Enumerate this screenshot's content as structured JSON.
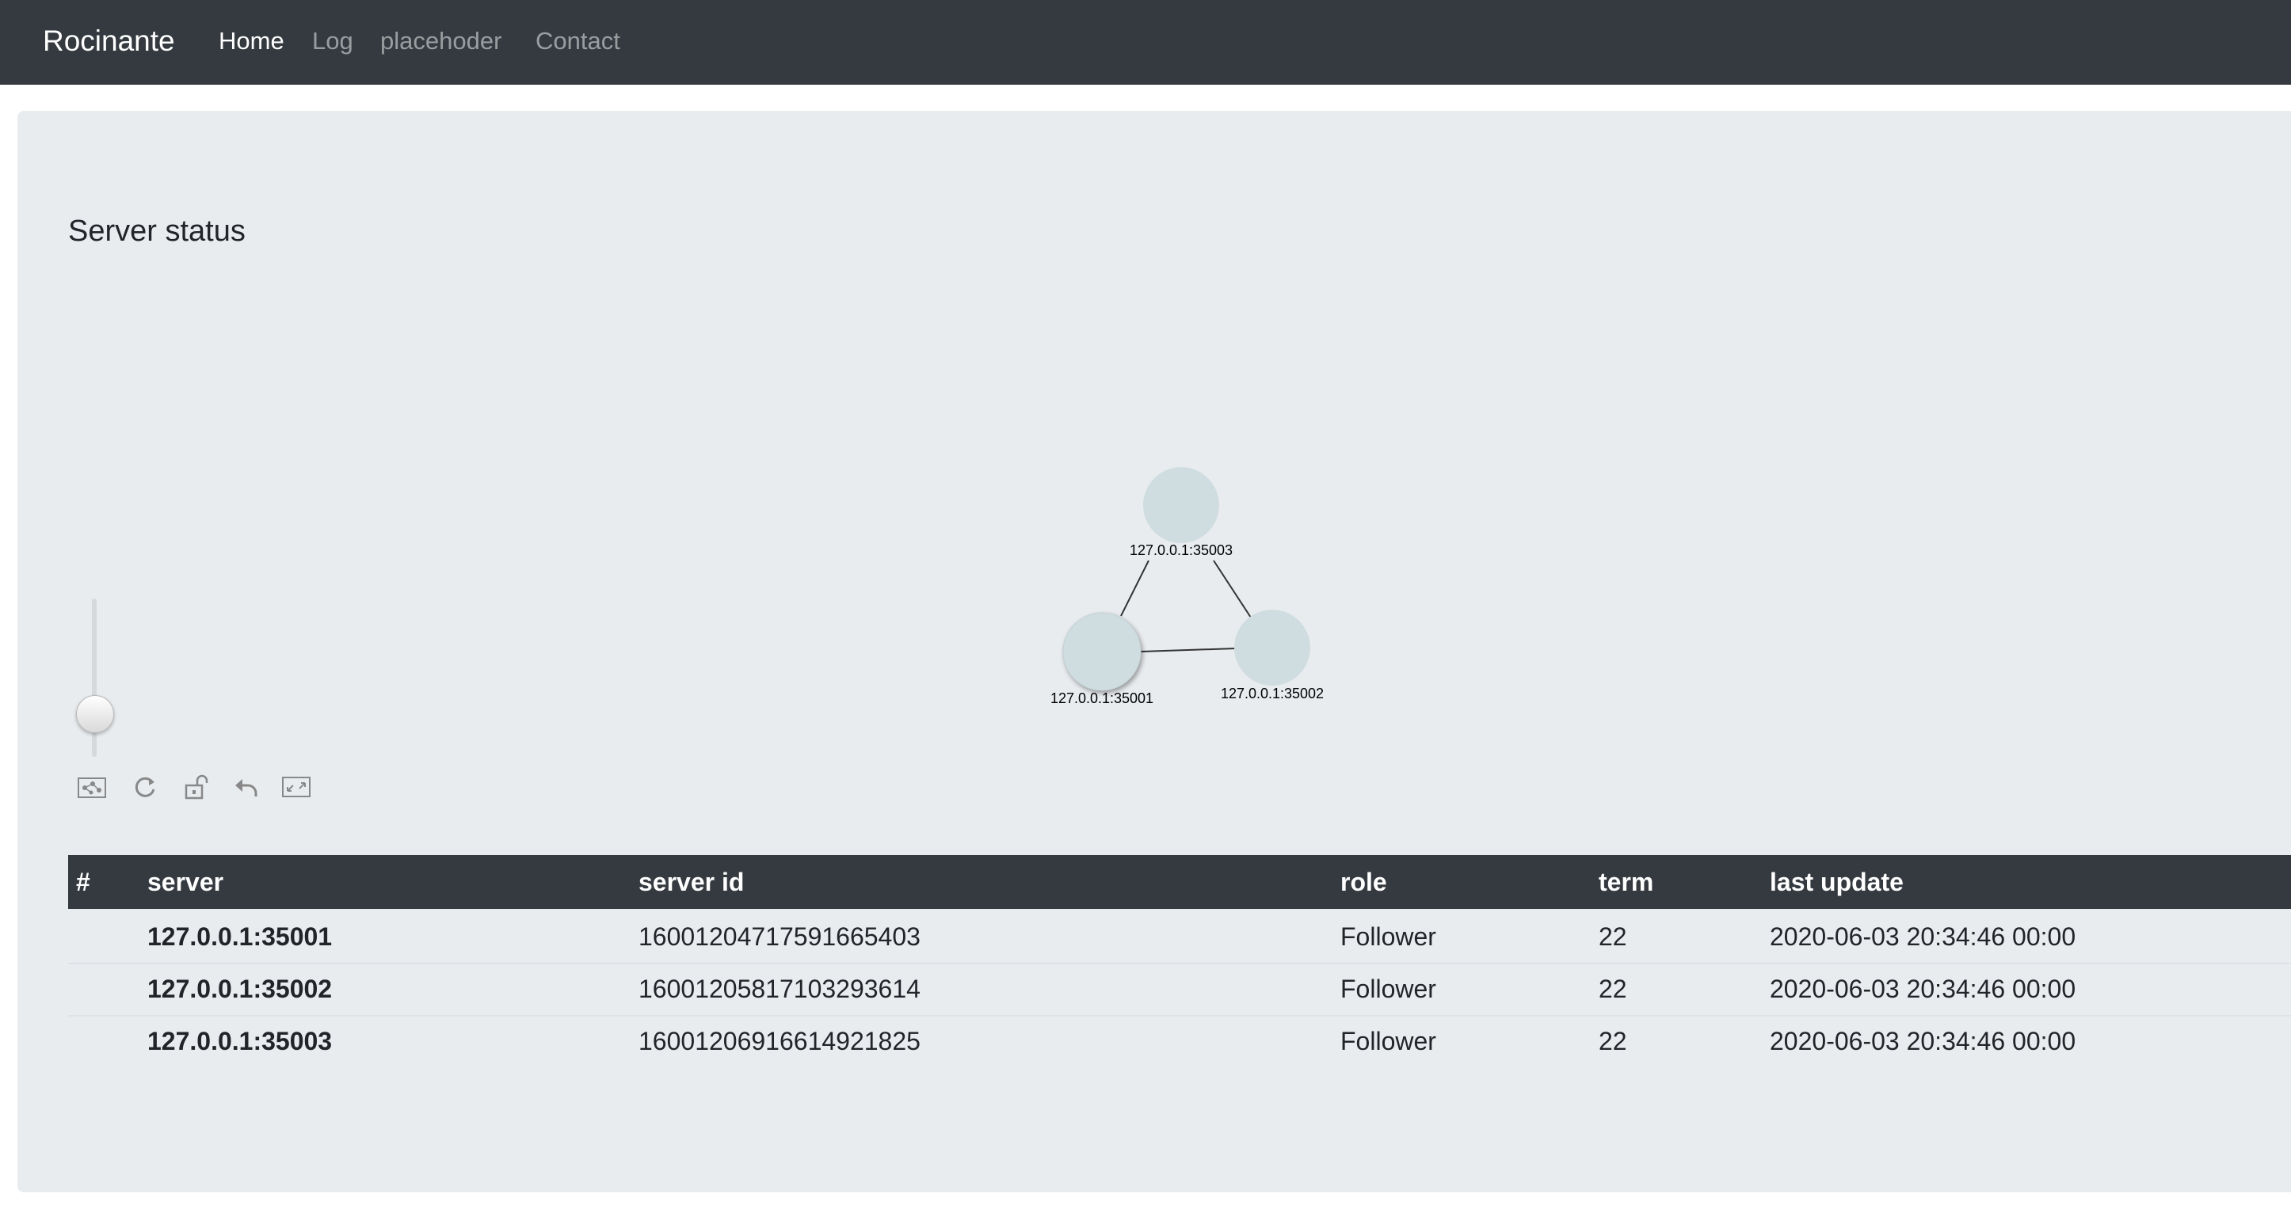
{
  "navbar": {
    "brand": "Rocinante",
    "links": [
      {
        "label": "Home",
        "active": true
      },
      {
        "label": "Log",
        "active": false
      },
      {
        "label": "placehoder",
        "active": false
      },
      {
        "label": "Contact",
        "active": false
      }
    ]
  },
  "page": {
    "title": "Server status"
  },
  "graph": {
    "nodes": [
      {
        "id": "n3",
        "label": "127.0.0.1:35003"
      },
      {
        "id": "n1",
        "label": "127.0.0.1:35001"
      },
      {
        "id": "n2",
        "label": "127.0.0.1:35002"
      }
    ],
    "edges": [
      [
        "n3",
        "n1"
      ],
      [
        "n3",
        "n2"
      ],
      [
        "n1",
        "n2"
      ]
    ],
    "node_color": "#cfdde1"
  },
  "graph_controls": {
    "zoom_level": 0.28,
    "tools": [
      "fit-graph-icon",
      "refresh-icon",
      "unlock-icon",
      "undo-icon",
      "fullscreen-icon"
    ]
  },
  "table": {
    "headers": {
      "index": "#",
      "server": "server",
      "server_id": "server id",
      "role": "role",
      "term": "term",
      "last_update": "last update"
    },
    "rows": [
      {
        "index": "",
        "server": "127.0.0.1:35001",
        "server_id": "16001204717591665403",
        "role": "Follower",
        "term": "22",
        "last_update": "2020-06-03 20:34:46 00:00"
      },
      {
        "index": "",
        "server": "127.0.0.1:35002",
        "server_id": "16001205817103293614",
        "role": "Follower",
        "term": "22",
        "last_update": "2020-06-03 20:34:46 00:00"
      },
      {
        "index": "",
        "server": "127.0.0.1:35003",
        "server_id": "16001206916614921825",
        "role": "Follower",
        "term": "22",
        "last_update": "2020-06-03 20:34:46 00:00"
      }
    ]
  },
  "colors": {
    "navbar_bg": "#343a40",
    "panel_bg": "#e9ecef",
    "table_head_bg": "#343a40"
  }
}
